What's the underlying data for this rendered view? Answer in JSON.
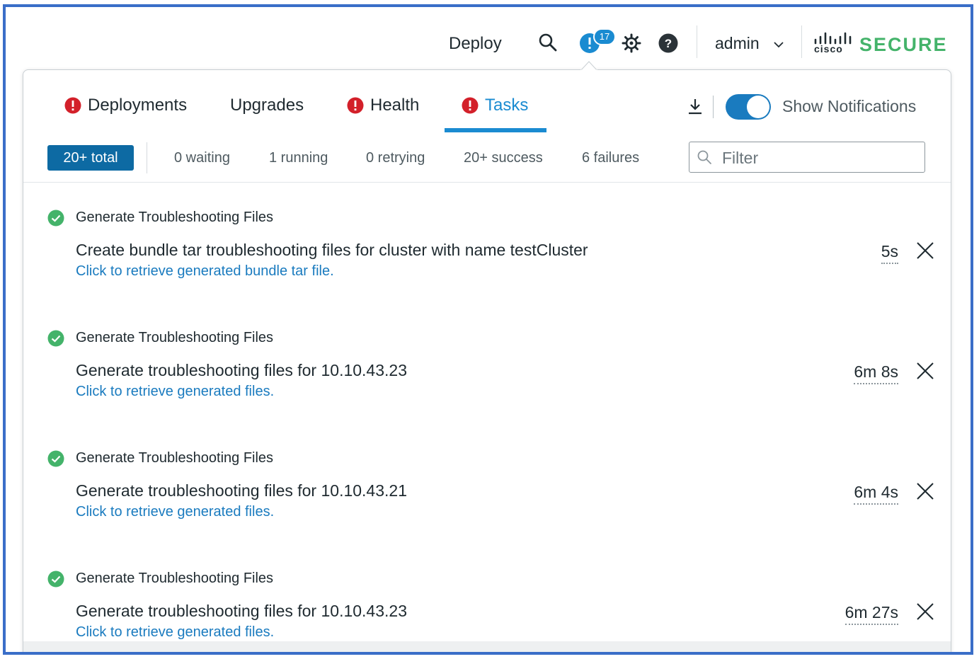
{
  "topnav": {
    "deploy_label": "Deploy",
    "alert_count": "17",
    "user_label": "admin",
    "brand_cisco": "cisco",
    "brand_secure": "SECURE",
    "colors": {
      "accent": "#1a8bd1",
      "brand_green": "#44b36a"
    }
  },
  "tabs": [
    {
      "label": "Deployments",
      "icon": "error-icon"
    },
    {
      "label": "Upgrades"
    },
    {
      "label": "Health",
      "icon": "error-icon"
    },
    {
      "label": "Tasks",
      "icon": "error-icon",
      "active": true
    }
  ],
  "toolbar": {
    "show_notifications_label": "Show Notifications",
    "show_notifications_on": true
  },
  "filters": {
    "total": "20+ total",
    "waiting": "0 waiting",
    "running": "1 running",
    "retrying": "0 retrying",
    "success": "20+ success",
    "failures": "6 failures",
    "placeholder": "Filter"
  },
  "tasks": [
    {
      "title": "Generate Troubleshooting Files",
      "description": "Create bundle tar troubleshooting files for cluster with name testCluster",
      "link": "Click to retrieve generated bundle tar file.",
      "duration": "5s",
      "status": "success"
    },
    {
      "title": "Generate Troubleshooting Files",
      "description": "Generate troubleshooting files for 10.10.43.23",
      "link": "Click to retrieve generated files.",
      "duration": "6m 8s",
      "status": "success"
    },
    {
      "title": "Generate Troubleshooting Files",
      "description": "Generate troubleshooting files for 10.10.43.21",
      "link": "Click to retrieve generated files.",
      "duration": "6m 4s",
      "status": "success"
    },
    {
      "title": "Generate Troubleshooting Files",
      "description": "Generate troubleshooting files for 10.10.43.23",
      "link": "Click to retrieve generated files.",
      "duration": "6m 27s",
      "status": "success"
    }
  ]
}
